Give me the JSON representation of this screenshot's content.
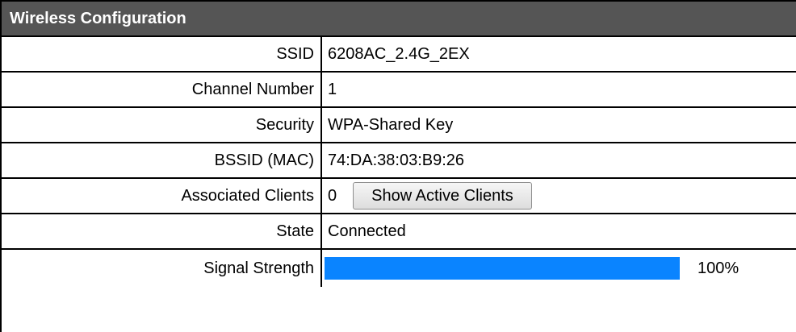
{
  "panel": {
    "title": "Wireless Configuration"
  },
  "rows": {
    "ssid": {
      "label": "SSID",
      "value": "6208AC_2.4G_2EX"
    },
    "channel": {
      "label": "Channel Number",
      "value": "1"
    },
    "security": {
      "label": "Security",
      "value": "WPA-Shared Key"
    },
    "bssid": {
      "label": "BSSID (MAC)",
      "value": "74:DA:38:03:B9:26"
    },
    "clients": {
      "label": "Associated Clients",
      "value": "0",
      "button_label": "Show Active Clients"
    },
    "state": {
      "label": "State",
      "value": "Connected"
    },
    "signal": {
      "label": "Signal Strength",
      "percent_text": "100%",
      "level": 1.0,
      "bar_color": "#0a84ff"
    }
  }
}
